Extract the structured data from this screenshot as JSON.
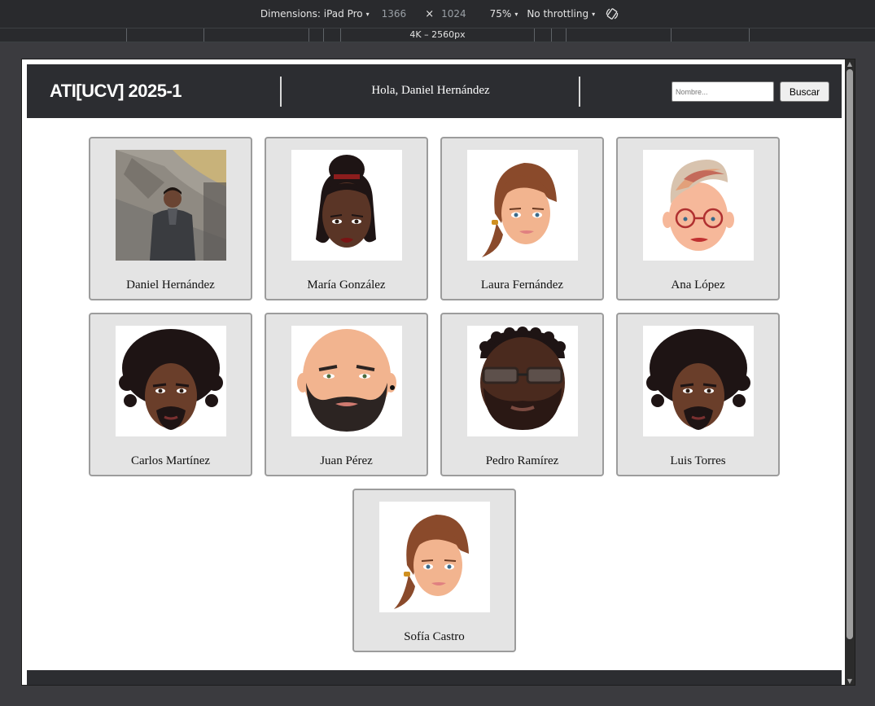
{
  "devtools": {
    "dimensions_label": "Dimensions: iPad Pro",
    "width": "1366",
    "height": "1024",
    "times": "×",
    "zoom": "75%",
    "throttling": "No throttling",
    "media_query_label": "4K – 2560px",
    "caret": "▾"
  },
  "header": {
    "brand": "ATI[UCV] 2025-1",
    "greeting": "Hola, Daniel Hernández",
    "search_placeholder": "Nombre...",
    "search_button": "Buscar"
  },
  "students": [
    {
      "name": "Daniel Hernández",
      "avatar": "photo"
    },
    {
      "name": "María González",
      "avatar": "woman-bun-icon"
    },
    {
      "name": "Laura Fernández",
      "avatar": "woman-ponytail-icon"
    },
    {
      "name": "Ana López",
      "avatar": "woman-glasses-icon"
    },
    {
      "name": "Carlos Martínez",
      "avatar": "man-curly-icon"
    },
    {
      "name": "Juan Pérez",
      "avatar": "man-bald-beard-icon"
    },
    {
      "name": "Pedro Ramírez",
      "avatar": "man-glasses-beard-icon"
    },
    {
      "name": "Luis Torres",
      "avatar": "man-curly-icon"
    },
    {
      "name": "Sofía Castro",
      "avatar": "woman-ponytail-icon"
    }
  ],
  "colors": {
    "header_bg": "#2c2d31",
    "card_bg": "#e4e4e4",
    "card_border": "#9c9c9c",
    "skin_light": "#f2b48f",
    "skin_dark": "#5a3526",
    "hair_brown": "#8a4a2b",
    "hair_black": "#1e1414"
  }
}
